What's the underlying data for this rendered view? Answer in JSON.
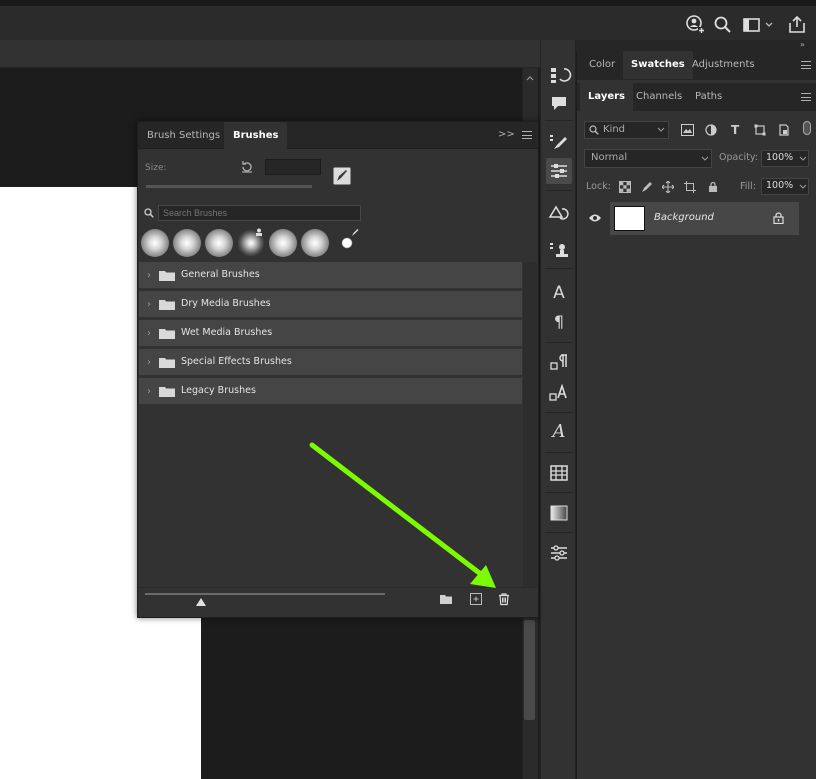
{
  "brushes_panel": {
    "tabs": [
      "Brush Settings",
      "Brushes"
    ],
    "size_label": "Size:",
    "search_placeholder": "Search Brushes",
    "folders": [
      "General Brushes",
      "Dry Media Brushes",
      "Wet Media Brushes",
      "Special Effects Brushes",
      "Legacy Brushes"
    ],
    "collapse_glyph": ">>"
  },
  "right_panels": {
    "top_tabs": [
      "Color",
      "Swatches",
      "Adjustments"
    ],
    "layer_tabs": [
      "Layers",
      "Channels",
      "Paths"
    ],
    "filter_kind": "Kind",
    "blend_mode": "Normal",
    "opacity_label": "Opacity:",
    "opacity_value": "100%",
    "lock_label": "Lock:",
    "fill_label": "Fill:",
    "fill_value": "100%",
    "layer_name": "Background"
  },
  "tool_strip": {
    "type_glyph": "A",
    "paragraph_glyph": "¶",
    "glyphs_glyph": "A"
  },
  "colors": {
    "annotation_arrow": "#7cfc00",
    "panel_bg": "#323232"
  }
}
